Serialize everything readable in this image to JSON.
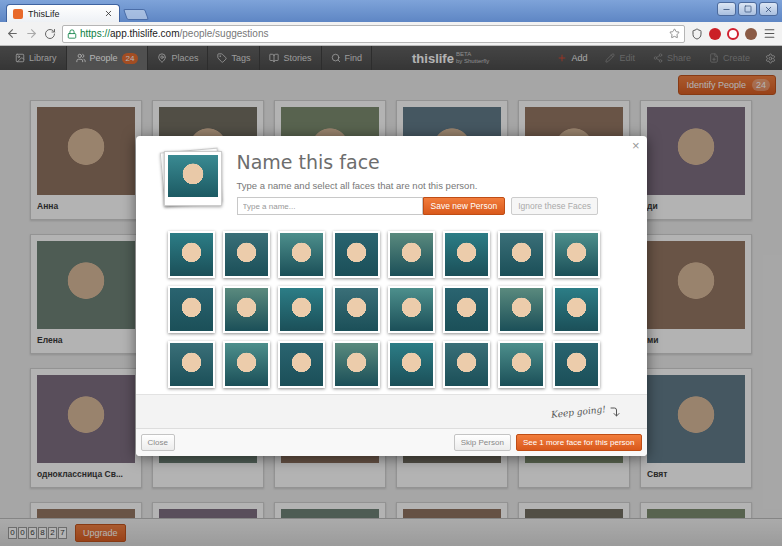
{
  "browser": {
    "tab": {
      "title": "ThisLife"
    },
    "url": {
      "scheme": "https://",
      "host": "app.thislife.com",
      "path": "/people/suggestions"
    }
  },
  "nav": {
    "items": [
      {
        "label": "Library",
        "selected": false
      },
      {
        "label": "People",
        "selected": true,
        "badge": "24"
      },
      {
        "label": "Places",
        "selected": false
      },
      {
        "label": "Tags",
        "selected": false
      },
      {
        "label": "Stories",
        "selected": false
      },
      {
        "label": "Find",
        "selected": false
      }
    ],
    "logo": {
      "name": "thislife",
      "tag": "BETA",
      "by": "by Shutterfly"
    },
    "actions": [
      {
        "label": "Add",
        "disabled": false
      },
      {
        "label": "Edit",
        "disabled": true
      },
      {
        "label": "Share",
        "disabled": true
      },
      {
        "label": "Create",
        "disabled": true
      }
    ]
  },
  "identify_button": {
    "label": "Identify People",
    "badge": "24"
  },
  "cards": [
    {
      "name": "Анна"
    },
    {
      "name": ""
    },
    {
      "name": ""
    },
    {
      "name": ""
    },
    {
      "name": ""
    },
    {
      "name": "ди"
    },
    {
      "name": "Елена"
    },
    {
      "name": ""
    },
    {
      "name": ""
    },
    {
      "name": ""
    },
    {
      "name": ""
    },
    {
      "name": "ми"
    },
    {
      "name": "одноклассница Св..."
    },
    {
      "name": ""
    },
    {
      "name": ""
    },
    {
      "name": ""
    },
    {
      "name": ""
    },
    {
      "name": "Свят"
    },
    {
      "name": ""
    },
    {
      "name": ""
    },
    {
      "name": ""
    },
    {
      "name": ""
    },
    {
      "name": ""
    },
    {
      "name": ""
    }
  ],
  "dialog": {
    "title": "Name this face",
    "close": "×",
    "instructions": "Type a name and select all faces that are not this person.",
    "name_input": {
      "placeholder": "Type a name...",
      "value": ""
    },
    "save_button": {
      "label": "Save new Person",
      "disabled": false
    },
    "ignore_button": {
      "label": "Ignore these Faces",
      "disabled": true
    },
    "faces": [
      {
        "selected": false
      },
      {
        "selected": false
      },
      {
        "selected": false
      },
      {
        "selected": false
      },
      {
        "selected": false
      },
      {
        "selected": false
      },
      {
        "selected": false
      },
      {
        "selected": false
      },
      {
        "selected": false
      },
      {
        "selected": false
      },
      {
        "selected": false
      },
      {
        "selected": false
      },
      {
        "selected": false
      },
      {
        "selected": false
      },
      {
        "selected": false
      },
      {
        "selected": false
      },
      {
        "selected": false
      },
      {
        "selected": false
      },
      {
        "selected": false
      },
      {
        "selected": false
      },
      {
        "selected": false
      },
      {
        "selected": false
      },
      {
        "selected": false
      },
      {
        "selected": false
      }
    ],
    "hint": "Keep going!",
    "buttons": {
      "close": "Close",
      "skip": "Skip Person",
      "more": "See 1 more face for this person"
    }
  },
  "footer": {
    "counter": [
      "0",
      "0",
      "6",
      "8",
      "2",
      "7"
    ],
    "upgrade": "Upgrade"
  }
}
